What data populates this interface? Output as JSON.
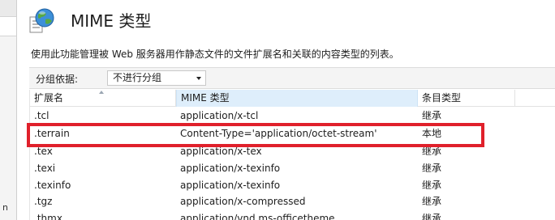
{
  "header": {
    "title": "MIME 类型",
    "icon": "globe-document-icon",
    "description": "使用此功能管理被 Web 服务器用作静态文件的文件扩展名和关联的内容类型的列表。"
  },
  "grouping": {
    "label": "分组依据:",
    "value": "不进行分组"
  },
  "table": {
    "columns": [
      "扩展名",
      "MIME 类型",
      "条目类型"
    ],
    "rows": [
      {
        "ext": ".tcl",
        "mime": "application/x-tcl",
        "type": "继承"
      },
      {
        "ext": ".terrain",
        "mime": "Content-Type='application/octet-stream'",
        "type": "本地"
      },
      {
        "ext": ".tex",
        "mime": "application/x-tex",
        "type": "继承"
      },
      {
        "ext": ".texi",
        "mime": "application/x-texinfo",
        "type": "继承"
      },
      {
        "ext": ".texinfo",
        "mime": "application/x-texinfo",
        "type": "继承"
      },
      {
        "ext": ".tgz",
        "mime": "application/x-compressed",
        "type": "继承"
      },
      {
        "ext": ".thmx",
        "mime": "application/vnd.ms-officetheme",
        "type": "继承"
      }
    ]
  },
  "left_pane": {
    "text": "n"
  },
  "colors": {
    "highlight": "#e0202b",
    "selected_header": "#deeefb"
  }
}
